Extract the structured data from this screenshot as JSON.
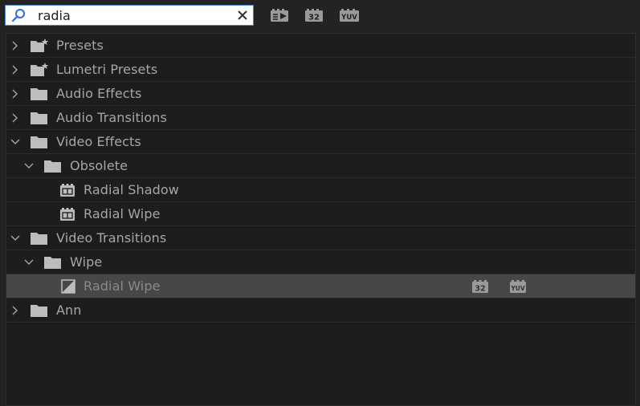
{
  "search": {
    "value": "radia",
    "placeholder": ""
  },
  "toolbar": {
    "accelerated_icon": "accelerated-effects-icon",
    "bit32_label": "32",
    "yuv_label": "YUV"
  },
  "tree": {
    "rows": [
      {
        "label": "Presets",
        "expanded": false,
        "icon": "preset-folder-icon"
      },
      {
        "label": "Lumetri Presets",
        "expanded": false,
        "icon": "preset-folder-icon"
      },
      {
        "label": "Audio Effects",
        "expanded": false,
        "icon": "folder-icon"
      },
      {
        "label": "Audio Transitions",
        "expanded": false,
        "icon": "folder-icon"
      },
      {
        "label": "Video Effects",
        "expanded": true,
        "icon": "folder-icon"
      },
      {
        "label": "Obsolete",
        "expanded": true,
        "icon": "folder-icon"
      },
      {
        "label": "Radial Shadow",
        "icon": "effect-icon"
      },
      {
        "label": "Radial Wipe",
        "icon": "effect-icon"
      },
      {
        "label": "Video Transitions",
        "expanded": true,
        "icon": "folder-icon"
      },
      {
        "label": "Wipe",
        "expanded": true,
        "icon": "folder-icon"
      },
      {
        "label": "Radial Wipe",
        "icon": "transition-icon",
        "selected": true,
        "badge_32": "32",
        "badge_yuv": "YUV"
      },
      {
        "label": "Ann",
        "expanded": false,
        "icon": "folder-icon"
      }
    ]
  },
  "colors": {
    "background": "#232323",
    "tree_background": "#1d1d1d",
    "selected_row": "#474747",
    "text": "#a6a6a6",
    "search_border": "#4a87d8"
  }
}
